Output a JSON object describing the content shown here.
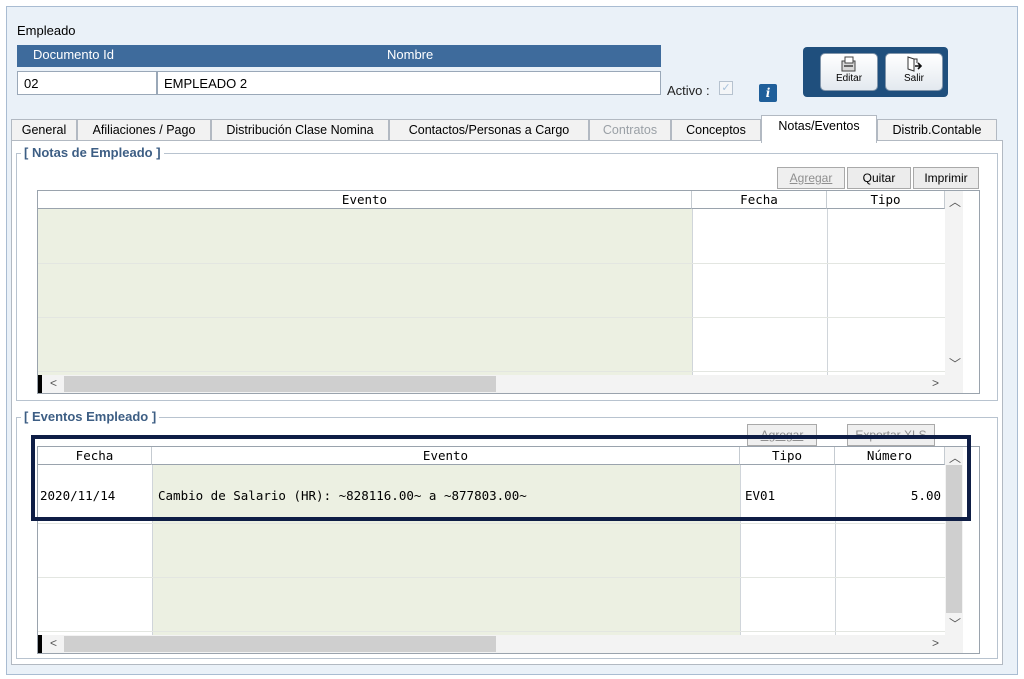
{
  "window": {
    "title": "Empleado"
  },
  "header": {
    "col_documento": "Documento Id",
    "col_nombre": "Nombre",
    "documento_value": "02",
    "nombre_value": "EMPLEADO 2",
    "activo_label": "Activo :",
    "activo_checked": "✓",
    "info_glyph": "i"
  },
  "toolbar": {
    "edit_label": "Editar",
    "exit_label": "Salir"
  },
  "tabs": [
    {
      "label": "General"
    },
    {
      "label": "Afiliaciones / Pago"
    },
    {
      "label": "Distribución Clase Nomina"
    },
    {
      "label": "Contactos/Personas a Cargo"
    },
    {
      "label": "Contratos"
    },
    {
      "label": "Conceptos"
    },
    {
      "label": "Notas/Eventos"
    },
    {
      "label": "Distrib.Contable"
    }
  ],
  "notas": {
    "title": "[ Notas de Empleado ]",
    "btn_add": "Agregar",
    "btn_remove": "Quitar",
    "btn_print": "Imprimir",
    "columns": [
      "Evento",
      "Fecha",
      "Tipo"
    ]
  },
  "eventos": {
    "title": "[ Eventos Empleado ]",
    "btn_add": "Agregar",
    "btn_export": "Exportar XLS",
    "columns": [
      "Fecha",
      "Evento",
      "Tipo",
      "Número"
    ],
    "rows": [
      {
        "fecha": "2020/11/14",
        "evento": "Cambio de Salario (HR): ~828116.00~ a ~877803.00~",
        "tipo": "EV01",
        "numero": "5.00"
      }
    ]
  },
  "scroll": {
    "up": "▲",
    "down": "▼",
    "left": "<",
    "right": ">"
  },
  "icons": [
    "edit-icon",
    "exit-door-icon",
    "checkbox-icon",
    "info-icon",
    "scroll-arrow-icons"
  ]
}
